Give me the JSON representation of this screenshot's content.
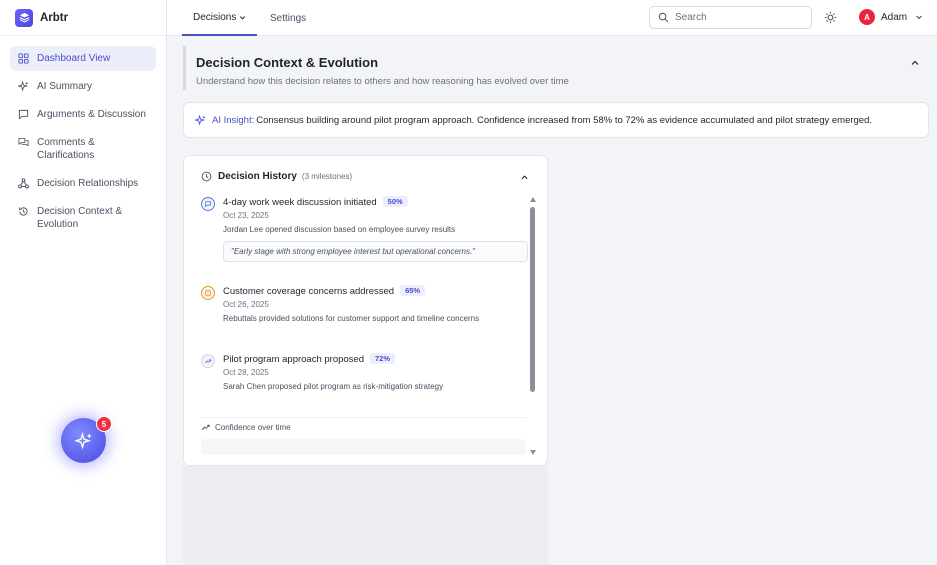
{
  "app": {
    "name": "Arbtr"
  },
  "topnav": {
    "tabs": [
      {
        "label": "Decisions",
        "active": true
      },
      {
        "label": "Settings",
        "active": false
      }
    ],
    "search_placeholder": "Search",
    "user": {
      "initial": "A",
      "name": "Adam"
    }
  },
  "sidebar": {
    "items": [
      {
        "label": "Dashboard View",
        "icon": "grid-icon",
        "active": true
      },
      {
        "label": "AI Summary",
        "icon": "sparkles-icon"
      },
      {
        "label": "Arguments & Discussion",
        "icon": "message-square-icon"
      },
      {
        "label": "Comments & Clarifications",
        "icon": "messages-icon"
      },
      {
        "label": "Decision Relationships",
        "icon": "network-icon"
      },
      {
        "label": "Decision Context & Evolution",
        "icon": "history-icon"
      }
    ],
    "fab_badge": "5"
  },
  "header": {
    "title": "Decision Context & Evolution",
    "subtitle": "Understand how this decision relates to others and how reasoning has evolved over time"
  },
  "insight": {
    "label": "AI Insight:",
    "text": "Consensus building around pilot program approach. Confidence increased from 58% to 72% as evidence accumulated and pilot strategy emerged."
  },
  "history": {
    "title": "Decision History",
    "count": "(3 milestones)",
    "milestones": [
      {
        "title": "4-day work week discussion initiated",
        "confidence": "50%",
        "date": "Oct 23, 2025",
        "description": "Jordan Lee opened discussion based on employee survey results",
        "quote": "\"Early stage with strong employee interest but operational concerns.\"",
        "icon": "message-circle-icon",
        "color": "#4a7fd6"
      },
      {
        "title": "Customer coverage concerns addressed",
        "confidence": "65%",
        "date": "Oct 26, 2025",
        "description": "Rebuttals provided solutions for customer support and timeline concerns",
        "icon": "alert-circle-icon",
        "color": "#e59a2b"
      },
      {
        "title": "Pilot program approach proposed",
        "confidence": "72%",
        "date": "Oct 28, 2025",
        "description": "Sarah Chen proposed pilot program as risk-mitigation strategy",
        "icon": "trending-up-icon",
        "color": "#7a5cd6"
      }
    ],
    "confidence_label": "Confidence over time"
  },
  "colors": {
    "accent": "#4a4fc9",
    "danger": "#e8263e"
  }
}
